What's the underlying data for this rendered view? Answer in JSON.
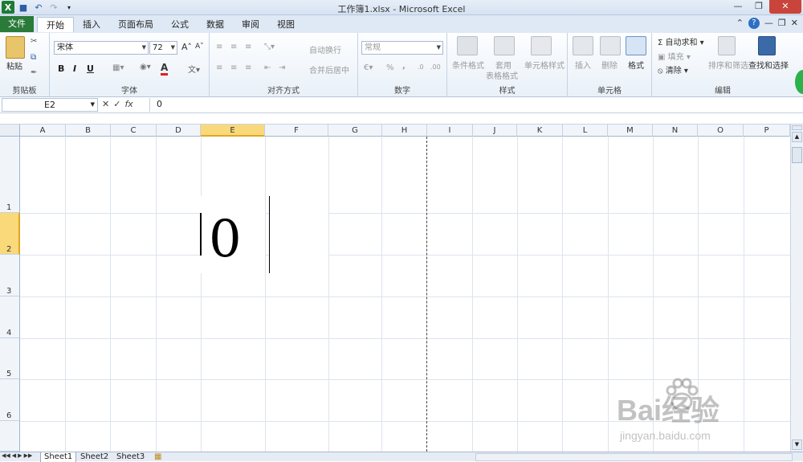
{
  "window": {
    "title": "工作簿1.xlsx - Microsoft Excel"
  },
  "tabs": {
    "file": "文件",
    "items": [
      "开始",
      "插入",
      "页面布局",
      "公式",
      "数据",
      "审阅",
      "视图"
    ],
    "active_index": 0
  },
  "ribbon": {
    "clipboard": {
      "paste": "粘贴",
      "label": "剪贴板"
    },
    "font": {
      "name": "宋体",
      "size": "72",
      "bold": "B",
      "italic": "I",
      "underline": "U",
      "label": "字体",
      "font_color": "#e02020"
    },
    "alignment": {
      "wrap": "自动换行",
      "merge": "合并后居中",
      "label": "对齐方式"
    },
    "number": {
      "format": "常规",
      "percent": "%",
      "comma": ",",
      "label": "数字"
    },
    "styles": {
      "conditional": "条件格式",
      "table1": "套用",
      "table2": "表格格式",
      "cell_styles": "单元格样式",
      "label": "样式"
    },
    "cells": {
      "insert": "插入",
      "delete": "删除",
      "format": "格式",
      "label": "单元格"
    },
    "editing": {
      "autosum": "自动求和",
      "fill": "填充",
      "clear": "清除",
      "sort": "排序和筛选",
      "find": "查找和选择",
      "label": "编辑"
    }
  },
  "formula_bar": {
    "name_box": "E2",
    "formula": "0"
  },
  "grid": {
    "columns": [
      "A",
      "B",
      "C",
      "D",
      "E",
      "F",
      "G",
      "H",
      "I",
      "J",
      "K",
      "L",
      "M",
      "N",
      "O",
      "P"
    ],
    "selected_column": "E",
    "rows": [
      "1",
      "2",
      "3",
      "4",
      "5",
      "6"
    ],
    "selected_row": "2",
    "cell_value": "0"
  },
  "sheets": [
    "Sheet1",
    "Sheet2",
    "Sheet3"
  ],
  "watermark": {
    "brand": "Bai经验",
    "url": "jingyan.baidu.com"
  }
}
